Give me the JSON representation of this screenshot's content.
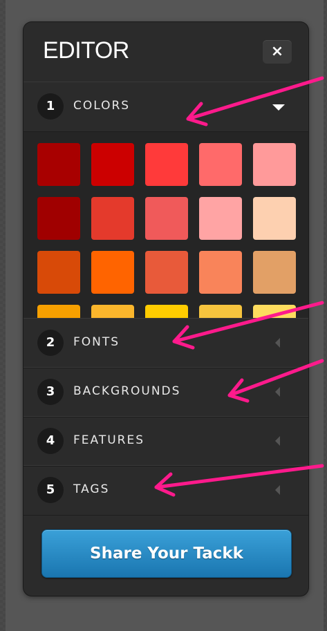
{
  "editor": {
    "title": "EDITOR",
    "close_label": "×",
    "sections": [
      {
        "number": "1",
        "label": "COLORS",
        "state": "expanded"
      },
      {
        "number": "2",
        "label": "FONTS",
        "state": "collapsed"
      },
      {
        "number": "3",
        "label": "BACKGROUNDS",
        "state": "collapsed"
      },
      {
        "number": "4",
        "label": "FEATURES",
        "state": "collapsed"
      },
      {
        "number": "5",
        "label": "TAGS",
        "state": "collapsed"
      }
    ],
    "swatch_colors": [
      [
        "#a80000",
        "#cc0000",
        "#ff3a3a",
        "#ff6a6a",
        "#ff9a9a"
      ],
      [
        "#a00000",
        "#e43a2c",
        "#f05a5a",
        "#ffa4a4",
        "#fdd0b0"
      ],
      [
        "#d84a08",
        "#ff6400",
        "#e85a3a",
        "#f9845a",
        "#e2a066"
      ],
      [
        "#f7a000",
        "#fbb62c",
        "#ffcc00",
        "#f6c43e",
        "#fddc5e"
      ]
    ],
    "share_button_label": "Share Your Tackk"
  },
  "annotation_color": "#ff1a8c"
}
